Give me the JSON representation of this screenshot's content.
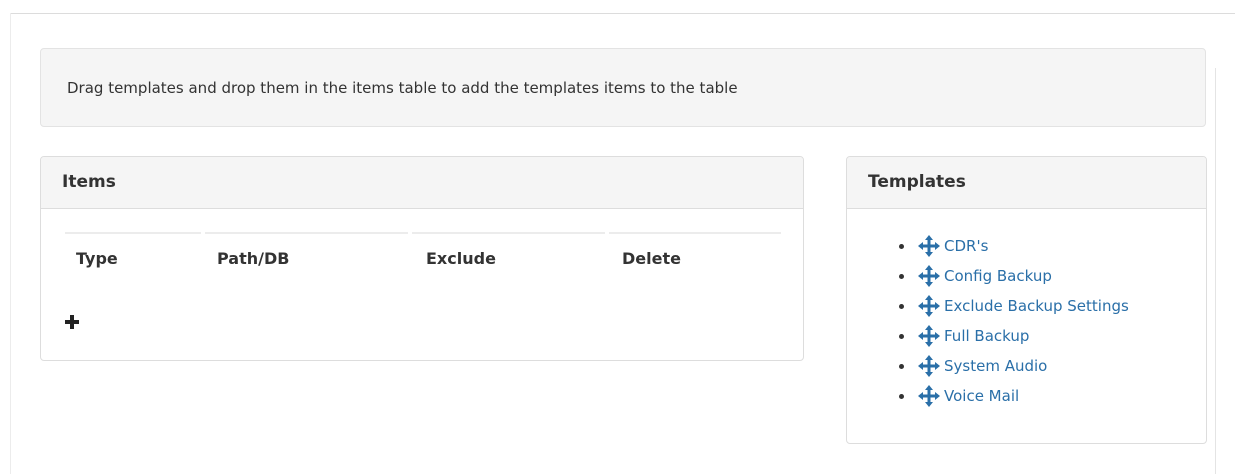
{
  "info": {
    "message": "Drag templates and drop them in the items table to add the templates items to the table"
  },
  "items_panel": {
    "title": "Items",
    "columns": [
      "Type",
      "Path/DB",
      "Exclude",
      "Delete"
    ],
    "add_icon": "plus-icon"
  },
  "templates_panel": {
    "title": "Templates",
    "item_icon": "move-arrows-icon",
    "items": [
      "CDR's",
      "Config Backup",
      "Exclude Backup Settings",
      "Full Backup",
      "System Audio",
      "Voice Mail"
    ]
  },
  "colors": {
    "link": "#2a6fa8",
    "panel_heading_bg": "#f5f5f5",
    "border": "#dddddd"
  }
}
